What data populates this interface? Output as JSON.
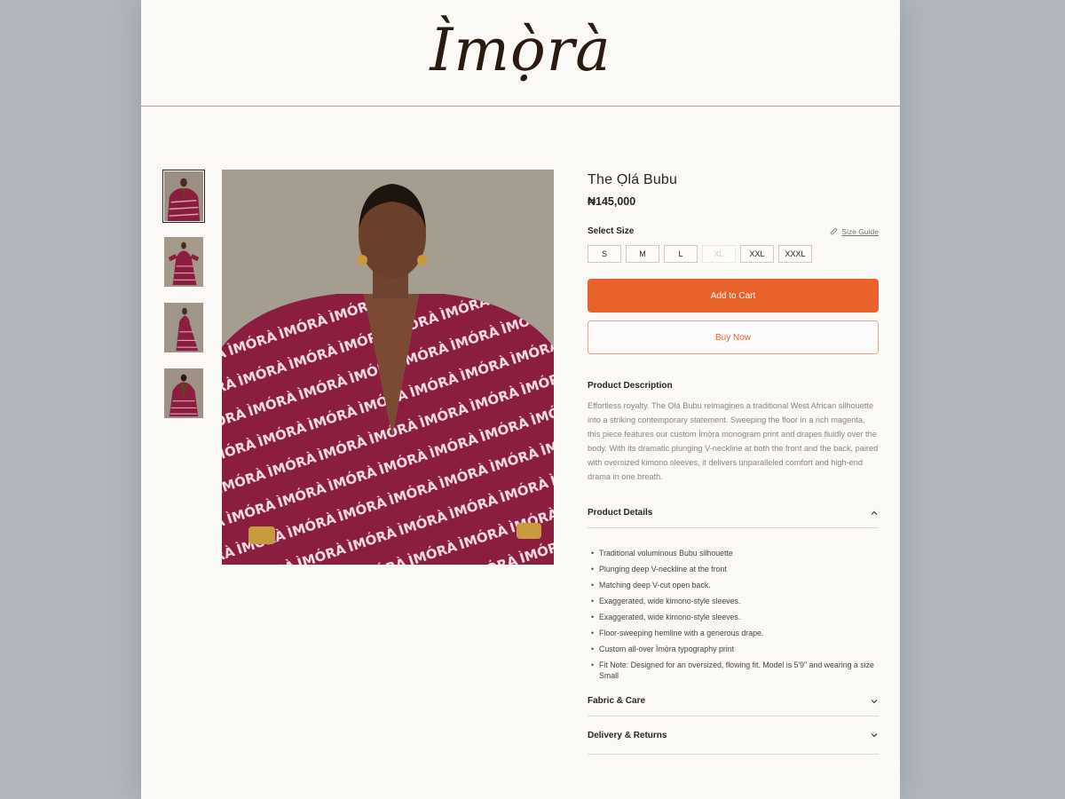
{
  "brand": {
    "logo_text": "Ìmọ̀rà"
  },
  "gallery": {
    "thumbnails": [
      {
        "icon": "model-front-image"
      },
      {
        "icon": "model-full-image"
      },
      {
        "icon": "model-side-image"
      },
      {
        "icon": "model-back-image"
      }
    ],
    "main_image_icon": "model-portrait-image"
  },
  "product": {
    "title": "The Ọlá Bubu",
    "price": "₦145,000"
  },
  "size": {
    "label": "Select Size",
    "guide_label": "Size Guide",
    "options": [
      {
        "label": "S",
        "available": true
      },
      {
        "label": "M",
        "available": true
      },
      {
        "label": "L",
        "available": true
      },
      {
        "label": "XL",
        "available": false
      },
      {
        "label": "XXL",
        "available": true
      },
      {
        "label": "XXXL",
        "available": true
      }
    ]
  },
  "actions": {
    "add_to_cart": "Add to Cart",
    "buy_now": "Buy Now"
  },
  "description": {
    "title": "Product Description",
    "text": "Effortless royalty. The Ọlá Bubu reimagines a traditional West African silhouette into a striking contemporary statement. Sweeping the floor in a rich magenta, this piece features our custom Ìmọ̀ra monogram print and drapes fluidly over the body. With its dramatic plunging V-neckline at both the front and the back, paired with oversized kimono sleeves, it delivers unparalleled comfort and high-end drama in one breath."
  },
  "details": {
    "title": "Product Details",
    "expanded": true,
    "items": [
      "Traditional voluminous Bubu silhouette",
      "Plunging deep V-neckline at the front",
      "Matching deep V-cut open back.",
      "Exaggerated, wide kimono-style sleeves.",
      "Exaggerated, wide kimono-style sleeves.",
      "Floor-sweeping hemline with a generous drape.",
      "Custom all-over Ìmọ̀ra typography print",
      "Fit Note: Designed for an oversized, flowing fit. Model is 5'9\" and wearing a size Small"
    ]
  },
  "fabric": {
    "title": "Fabric & Care",
    "expanded": false
  },
  "delivery": {
    "title": "Delivery & Returns",
    "expanded": false
  },
  "colors": {
    "accent": "#e9612b",
    "page_bg": "#fbf9f5",
    "backdrop": "#b2b6bf",
    "garment": "#8b1d3f"
  }
}
